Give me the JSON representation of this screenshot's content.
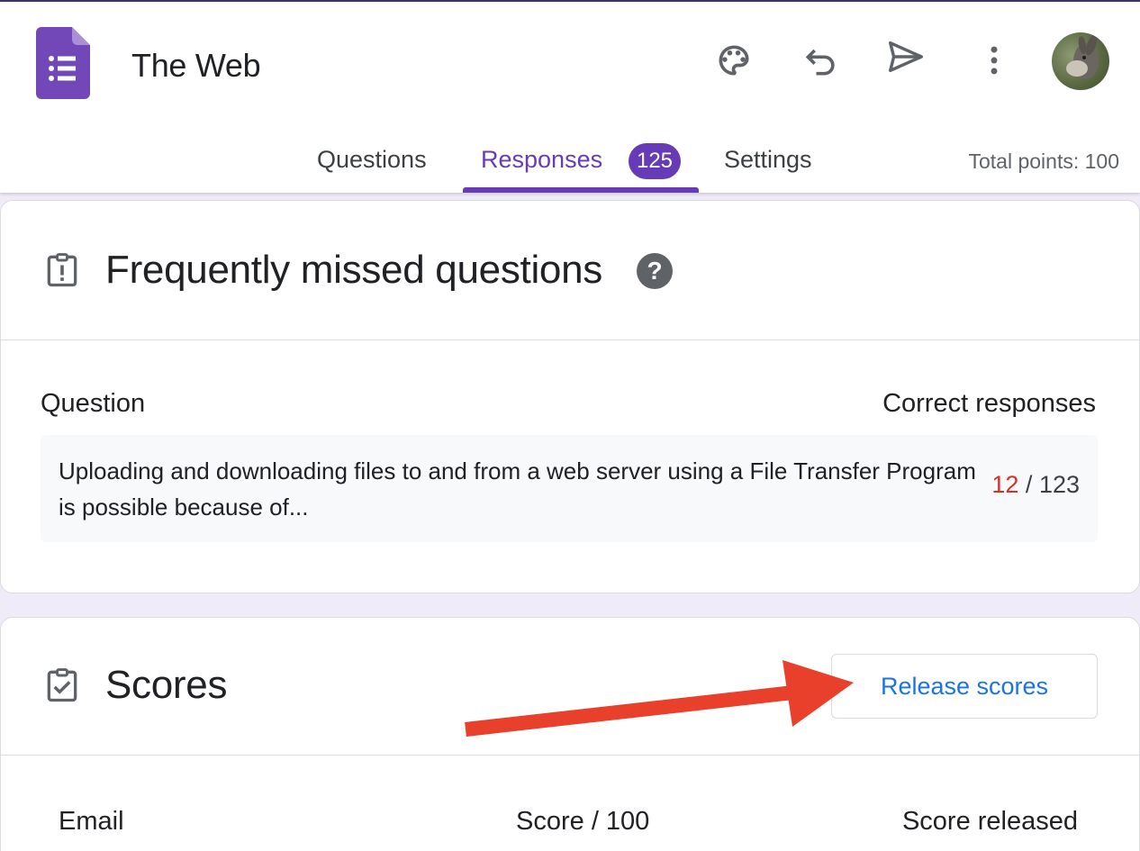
{
  "app": {
    "title": "The Web",
    "brand_color": "#673ab7"
  },
  "toolbar": {
    "icons": [
      "palette-icon",
      "undo-icon",
      "send-icon",
      "more-vert-icon",
      "avatar"
    ]
  },
  "tabs": [
    {
      "label": "Questions",
      "active": false
    },
    {
      "label": "Responses",
      "active": true,
      "badge": "125"
    },
    {
      "label": "Settings",
      "active": false
    }
  ],
  "total_points": "Total points: 100",
  "missed": {
    "title": "Frequently missed questions",
    "col_question": "Question",
    "col_correct": "Correct responses",
    "rows": [
      {
        "question": "Uploading and downloading files to and from a web server using a File Transfer Program is possible because of...",
        "correct": "12",
        "separator": "/",
        "total": "123"
      }
    ]
  },
  "scores": {
    "title": "Scores",
    "release_label": "Release scores",
    "col_email": "Email",
    "col_score": "Score / 100",
    "col_released": "Score released"
  },
  "colors": {
    "accent": "#673ab7",
    "link": "#1a73e8",
    "missed": "#d93025",
    "arrow": "#e8402a"
  }
}
